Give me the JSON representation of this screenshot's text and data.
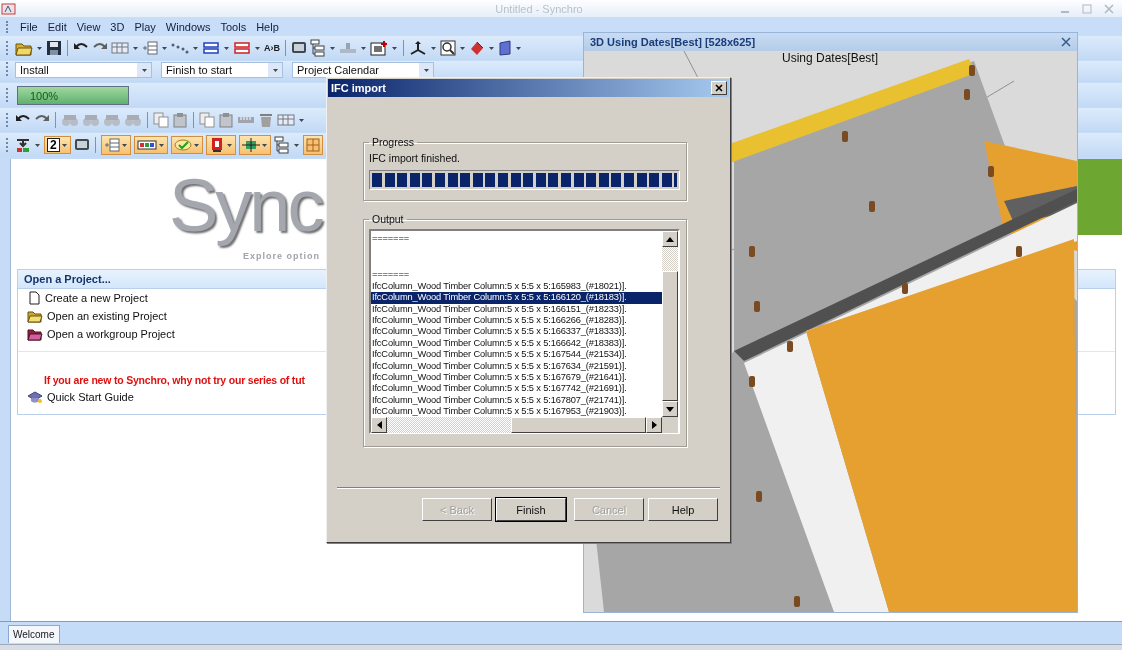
{
  "window": {
    "title": "Untitled - Synchro"
  },
  "menu": [
    {
      "label": "File"
    },
    {
      "label": "Edit"
    },
    {
      "label": "View"
    },
    {
      "label": "3D"
    },
    {
      "label": "Play"
    },
    {
      "label": "Windows"
    },
    {
      "label": "Tools"
    },
    {
      "label": "Help"
    }
  ],
  "toolbar": {
    "swap_label": "A›B",
    "level_label": "2"
  },
  "combos": [
    {
      "value": "Install"
    },
    {
      "value": "Finish to start"
    },
    {
      "value": "Project Calendar"
    }
  ],
  "progress": {
    "level": 1,
    "reading": "100%"
  },
  "welcome": {
    "logo": "Sync",
    "tagline": "Explore option",
    "section_title": "Open a Project...",
    "actions": [
      {
        "label": "Create a new Project",
        "kind": "new"
      },
      {
        "label": "Open an existing Project",
        "kind": "open"
      },
      {
        "label": "Open a workgroup Project",
        "kind": "workgroup"
      }
    ],
    "notice": "If you are new to Synchro, why not try our series of tut",
    "guides": [
      {
        "label": "Quick Start Guide"
      }
    ]
  },
  "view_3d": {
    "title": "3D Using Dates[Best] [528x625]",
    "caption": "Using Dates[Best]"
  },
  "dialog": {
    "title": "IFC import",
    "progress_group": "Progress",
    "status": "IFC import finished.",
    "level": 1,
    "output_group": "Output",
    "lines": [
      {
        "text": "=======",
        "selected": false
      },
      {
        "text": "=======",
        "selected": false
      },
      {
        "text": "IfcColumn_Wood Timber Column:5 x 5:5 x 5:165983_(#18021)].",
        "selected": false
      },
      {
        "text": "IfcColumn_Wood Timber Column:5 x 5:5 x 5:166120_(#18183)].",
        "selected": true
      },
      {
        "text": "IfcColumn_Wood Timber Column:5 x 5:5 x 5:166151_(#18233)].",
        "selected": false
      },
      {
        "text": "IfcColumn_Wood Timber Column:5 x 5:5 x 5:166266_(#18283)].",
        "selected": false
      },
      {
        "text": "IfcColumn_Wood Timber Column:5 x 5:5 x 5:166337_(#18333)].",
        "selected": false
      },
      {
        "text": "IfcColumn_Wood Timber Column:5 x 5:5 x 5:166642_(#18383)].",
        "selected": false
      },
      {
        "text": "IfcColumn_Wood Timber Column:5 x 5:5 x 5:167544_(#21534)].",
        "selected": false
      },
      {
        "text": "IfcColumn_Wood Timber Column:5 x 5:5 x 5:167634_(#21591)].",
        "selected": false
      },
      {
        "text": "IfcColumn_Wood Timber Column:5 x 5:5 x 5:167679_(#21641)].",
        "selected": false
      },
      {
        "text": "IfcColumn_Wood Timber Column:5 x 5:5 x 5:167742_(#21691)].",
        "selected": false
      },
      {
        "text": "IfcColumn_Wood Timber Column:5 x 5:5 x 5:167807_(#21741)].",
        "selected": false
      },
      {
        "text": "IfcColumn_Wood Timber Column:5 x 5:5 x 5:167953_(#21903)].",
        "selected": false
      }
    ],
    "buttons": [
      {
        "label": "< Back",
        "disabled": true,
        "default": false
      },
      {
        "label": "Finish",
        "disabled": false,
        "default": true
      },
      {
        "label": "Cancel",
        "disabled": true,
        "default": false
      },
      {
        "label": "Help",
        "disabled": false,
        "default": false
      }
    ]
  },
  "tabs": [
    {
      "label": "Welcome",
      "selected": true
    }
  ]
}
